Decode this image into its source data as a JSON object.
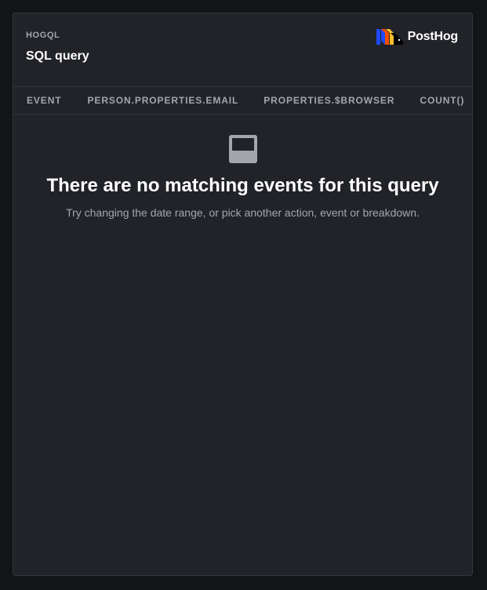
{
  "header": {
    "eyebrow": "HOGQL",
    "title": "SQL query",
    "logo_text": "PostHog"
  },
  "table": {
    "columns": [
      "EVENT",
      "PERSON.PROPERTIES.EMAIL",
      "PROPERTIES.$BROWSER",
      "COUNT()"
    ]
  },
  "empty_state": {
    "icon": "inbox-icon",
    "title": "There are no matching events for this query",
    "subtitle": "Try changing the date range, or pick another action, event or breakdown."
  },
  "colors": {
    "background": "#131416",
    "card": "#212328",
    "border": "#34363c",
    "muted_text": "#a4a6ad",
    "logo_blue": "#1d4aff",
    "logo_orange": "#f54e00",
    "logo_yellow": "#f9bd2b"
  }
}
